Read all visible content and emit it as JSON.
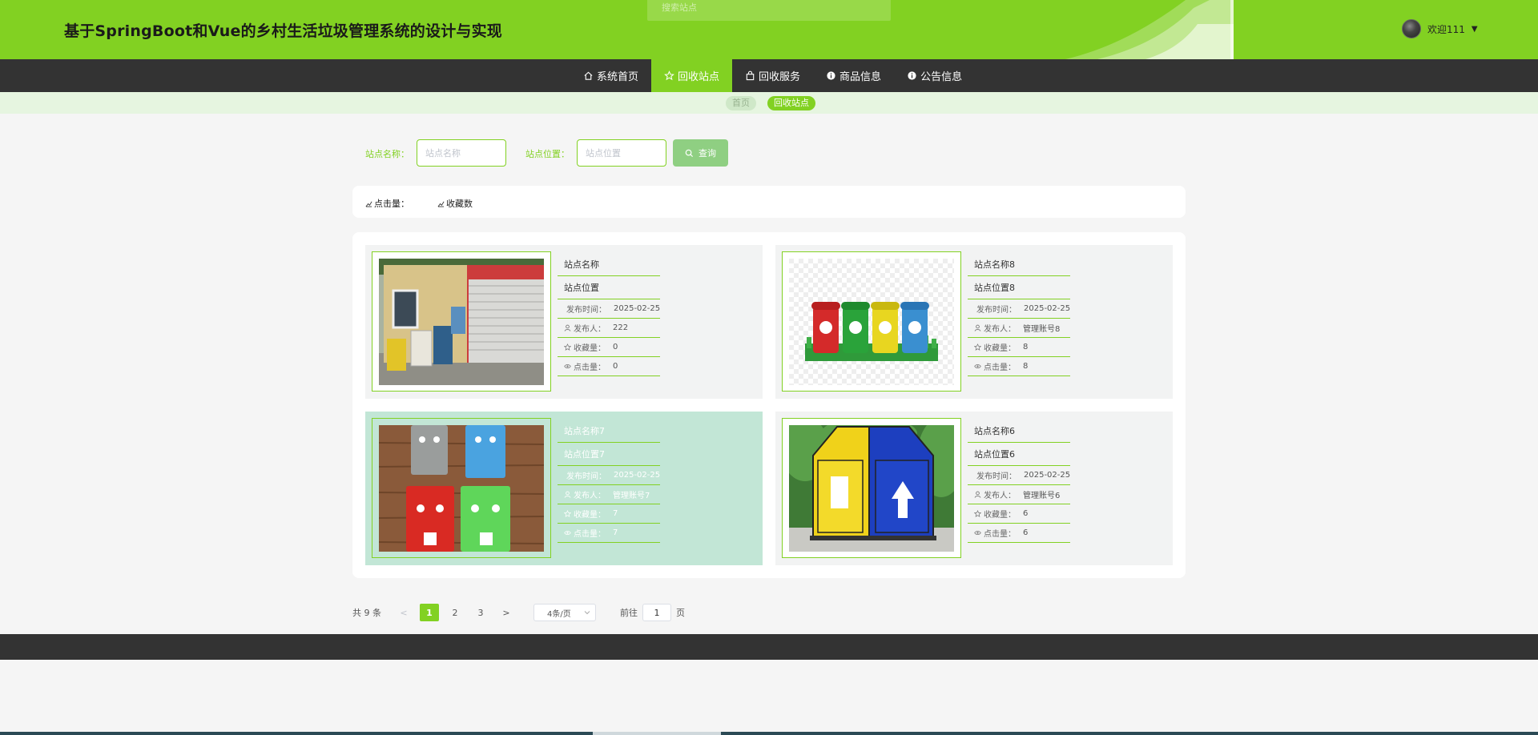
{
  "header": {
    "title": "基于SpringBoot和Vue的乡村生活垃圾管理系统的设计与实现",
    "ghost_search": "搜索站点",
    "user_label": "欢迎111",
    "brand_color": "#82d122"
  },
  "nav": {
    "items": [
      {
        "label": "系统首页",
        "icon": "home-icon"
      },
      {
        "label": "回收站点",
        "icon": "star-icon"
      },
      {
        "label": "回收服务",
        "icon": "bag-icon"
      },
      {
        "label": "商品信息",
        "icon": "info-icon"
      },
      {
        "label": "公告信息",
        "icon": "info-icon"
      }
    ],
    "active_index": 1
  },
  "breadcrumb": {
    "home": "首页",
    "current": "回收站点"
  },
  "search": {
    "name_label": "站点名称：",
    "name_placeholder": "站点名称",
    "location_label": "站点位置：",
    "location_placeholder": "站点位置",
    "button_label": "查询"
  },
  "sort": {
    "clicks": "点击量：",
    "favorites": "收藏数"
  },
  "cards": [
    {
      "name": "站点名称",
      "location": "站点位置",
      "time_label": "发布时间：",
      "time": "2025-02-25",
      "publisher_label": "发布人：",
      "publisher": "222",
      "fav_label": "收藏量：",
      "fav": "0",
      "click_label": "点击量：",
      "clicks": "0",
      "image": "recycling-kiosk"
    },
    {
      "name": "站点名称8",
      "location": "站点位置8",
      "time_label": "发布时间：",
      "time": "2025-02-25",
      "publisher_label": "发布人：",
      "publisher": "管理账号8",
      "fav_label": "收藏量：",
      "fav": "8",
      "click_label": "点击量：",
      "clicks": "8",
      "image": "four-color-bins"
    },
    {
      "name": "站点名称7",
      "location": "站点位置7",
      "time_label": "发布时间：",
      "time": "2025-02-25",
      "publisher_label": "发布人：",
      "publisher": "管理账号7",
      "fav_label": "收藏量：",
      "fav": "7",
      "click_label": "点击量：",
      "clicks": "7",
      "image": "smiling-bins"
    },
    {
      "name": "站点名称6",
      "location": "站点位置6",
      "time_label": "发布时间：",
      "time": "2025-02-25",
      "publisher_label": "发布人：",
      "publisher": "管理账号6",
      "fav_label": "收藏量：",
      "fav": "6",
      "click_label": "点击量：",
      "clicks": "6",
      "image": "yellow-blue-bin"
    }
  ],
  "pagination": {
    "total": "共 9 条",
    "prev": "<",
    "pages": [
      "1",
      "2",
      "3"
    ],
    "next": ">",
    "current": "1",
    "page_size": "4条/页",
    "goto_label": "前往",
    "goto_value": "1",
    "goto_suffix": "页"
  }
}
